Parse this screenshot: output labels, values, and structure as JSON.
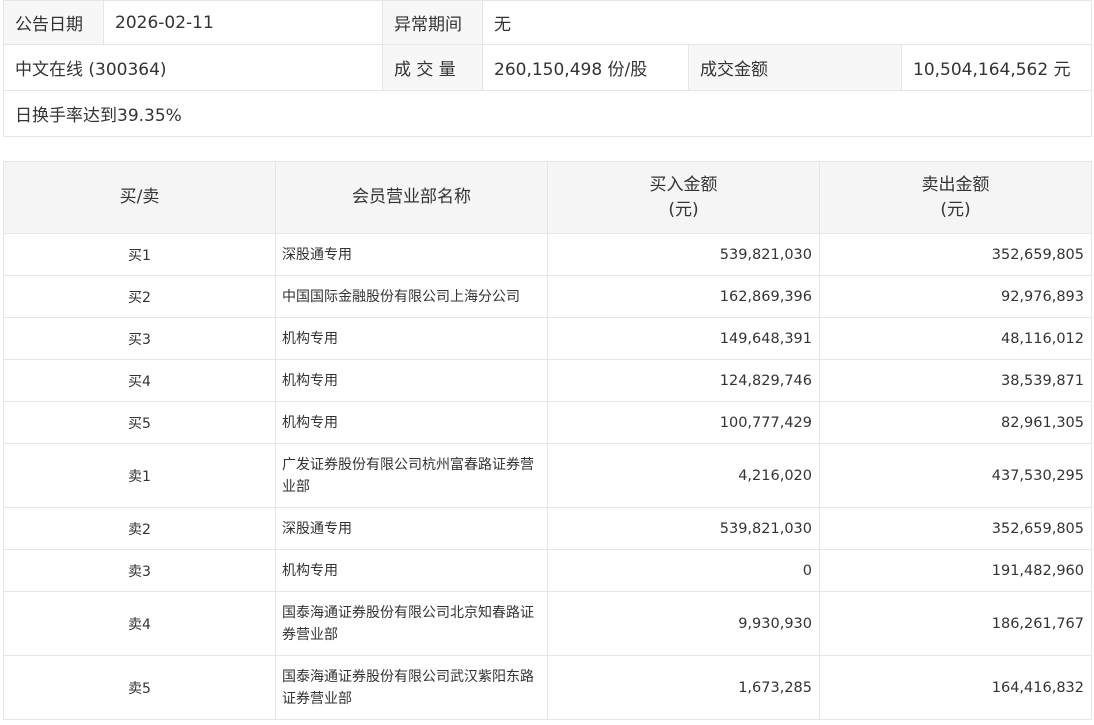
{
  "info": {
    "announce_date_label": "公告日期",
    "announce_date": "2026-02-11",
    "abnormal_period_label": "异常期间",
    "abnormal_period": "无",
    "stock": "中文在线 (300364)",
    "volume_label": "成 交 量",
    "volume": "260,150,498 份/股",
    "amount_label": "成交金额",
    "amount": "10,504,164,562 元",
    "reason": "日换手率达到39.35%"
  },
  "trades": {
    "headers": {
      "side": "买/卖",
      "member": "会员营业部名称",
      "buy_line1": "买入金额",
      "buy_line2": "(元)",
      "sell_line1": "卖出金额",
      "sell_line2": "(元)"
    },
    "rows": [
      {
        "side": "买1",
        "member": "深股通专用",
        "buy": "539,821,030",
        "sell": "352,659,805"
      },
      {
        "side": "买2",
        "member": "中国国际金融股份有限公司上海分公司",
        "buy": "162,869,396",
        "sell": "92,976,893"
      },
      {
        "side": "买3",
        "member": "机构专用",
        "buy": "149,648,391",
        "sell": "48,116,012"
      },
      {
        "side": "买4",
        "member": "机构专用",
        "buy": "124,829,746",
        "sell": "38,539,871"
      },
      {
        "side": "买5",
        "member": "机构专用",
        "buy": "100,777,429",
        "sell": "82,961,305"
      },
      {
        "side": "卖1",
        "member": "广发证券股份有限公司杭州富春路证券营业部",
        "buy": "4,216,020",
        "sell": "437,530,295"
      },
      {
        "side": "卖2",
        "member": "深股通专用",
        "buy": "539,821,030",
        "sell": "352,659,805"
      },
      {
        "side": "卖3",
        "member": "机构专用",
        "buy": "0",
        "sell": "191,482,960"
      },
      {
        "side": "卖4",
        "member": "国泰海通证券股份有限公司北京知春路证券营业部",
        "buy": "9,930,930",
        "sell": "186,261,767"
      },
      {
        "side": "卖5",
        "member": "国泰海通证券股份有限公司武汉紫阳东路证券营业部",
        "buy": "1,673,285",
        "sell": "164,416,832"
      }
    ]
  }
}
